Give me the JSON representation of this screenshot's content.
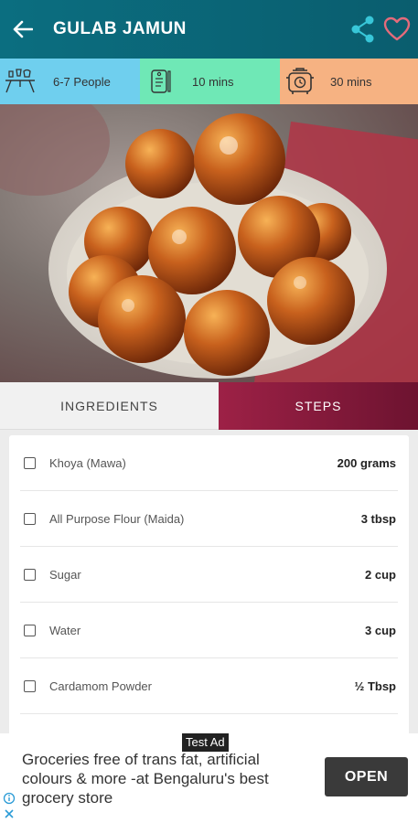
{
  "header": {
    "title": "GULAB JAMUN",
    "back_icon": "back-arrow-icon",
    "share_icon": "share-icon",
    "favorite_icon": "heart-icon"
  },
  "info": {
    "servings": "6-7 People",
    "prep_time": "10 mins",
    "cook_time": "30 mins"
  },
  "tabs": {
    "ingredients": "INGREDIENTS",
    "steps": "STEPS",
    "active": "STEPS"
  },
  "ingredients": [
    {
      "name": "Khoya (Mawa)",
      "qty": "200 grams"
    },
    {
      "name": "All Purpose Flour (Maida)",
      "qty": "3 tbsp"
    },
    {
      "name": "Sugar",
      "qty": "2 cup"
    },
    {
      "name": "Water",
      "qty": "3 cup"
    },
    {
      "name": "Cardamom Powder",
      "qty": "½ Tbsp"
    }
  ],
  "ad": {
    "tag": "Test Ad",
    "text": "Groceries free of trans fat, artificial colours & more -at Bengaluru's best grocery store",
    "button": "OPEN"
  },
  "colors": {
    "header": "#0b6e80",
    "accent_cyan": "#38c6d8",
    "heart": "#e36b7b",
    "servings_bg": "#6fcfee",
    "prep_bg": "#6fe8b6",
    "cook_bg": "#f6b282",
    "steps_tab": "#9d2146"
  }
}
